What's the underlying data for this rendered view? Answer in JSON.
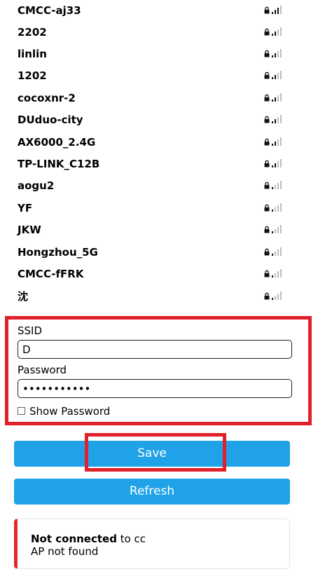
{
  "networks": [
    {
      "ssid": "CMCC-aj33",
      "locked": true,
      "signal": 3
    },
    {
      "ssid": "2202",
      "locked": true,
      "signal": 2
    },
    {
      "ssid": "linlin",
      "locked": true,
      "signal": 2
    },
    {
      "ssid": "1202",
      "locked": true,
      "signal": 2
    },
    {
      "ssid": "cocoxnr-2",
      "locked": true,
      "signal": 2
    },
    {
      "ssid": "DUduo-city",
      "locked": true,
      "signal": 2
    },
    {
      "ssid": "AX6000_2.4G",
      "locked": true,
      "signal": 2
    },
    {
      "ssid": "TP-LINK_C12B",
      "locked": true,
      "signal": 2
    },
    {
      "ssid": "aogu2",
      "locked": true,
      "signal": 1
    },
    {
      "ssid": "YF",
      "locked": true,
      "signal": 1
    },
    {
      "ssid": "JKW",
      "locked": true,
      "signal": 1
    },
    {
      "ssid": "Hongzhou_5G",
      "locked": true,
      "signal": 1
    },
    {
      "ssid": "CMCC-fFRK",
      "locked": true,
      "signal": 1
    },
    {
      "ssid": "沈",
      "locked": true,
      "signal": 1
    }
  ],
  "form": {
    "ssid_label": "SSID",
    "ssid_value": "D",
    "password_label": "Password",
    "password_value": "•••••••••••",
    "show_password_label": "Show Password",
    "show_password_checked": false
  },
  "buttons": {
    "save_label": "Save",
    "refresh_label": "Refresh"
  },
  "status": {
    "state": "Not connected",
    "to_text": " to cc",
    "detail": "AP not found"
  },
  "colors": {
    "button": "#1fa2e8",
    "highlight": "#e0202a",
    "status_bar": "#dd2a2a"
  },
  "icons": {
    "lock": "lock-icon",
    "signal": "wifi-signal-icon"
  }
}
